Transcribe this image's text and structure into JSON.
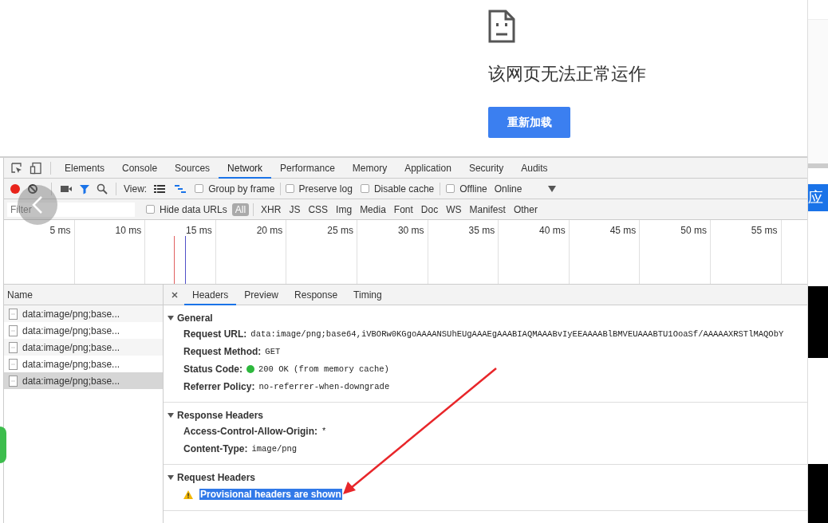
{
  "error_page": {
    "message": "该网页无法正常运作",
    "button": "重新加载"
  },
  "devtools": {
    "tabs": [
      {
        "label": "Elements",
        "selected": false
      },
      {
        "label": "Console",
        "selected": false
      },
      {
        "label": "Sources",
        "selected": false
      },
      {
        "label": "Network",
        "selected": true
      },
      {
        "label": "Performance",
        "selected": false
      },
      {
        "label": "Memory",
        "selected": false
      },
      {
        "label": "Application",
        "selected": false
      },
      {
        "label": "Security",
        "selected": false
      },
      {
        "label": "Audits",
        "selected": false
      }
    ],
    "toolbar": {
      "recording": true,
      "filter_active": true,
      "view_label": "View:",
      "view_modes": [
        {
          "kind": "list",
          "selected": false
        },
        {
          "kind": "waterfall",
          "selected": true
        }
      ],
      "options": [
        {
          "label": "Group by frame",
          "checked": false
        },
        {
          "label": "Preserve log",
          "checked": false
        },
        {
          "label": "Disable cache",
          "checked": false
        }
      ],
      "offline": {
        "label": "Offline",
        "checked": false
      },
      "throttling": "Online"
    },
    "filter_bar": {
      "placeholder": "Filter",
      "hide_data_urls": {
        "label": "Hide data URLs",
        "checked": false
      },
      "types": [
        {
          "label": "All",
          "selected": true
        },
        {
          "label": "XHR",
          "selected": false
        },
        {
          "label": "JS",
          "selected": false
        },
        {
          "label": "CSS",
          "selected": false
        },
        {
          "label": "Img",
          "selected": false
        },
        {
          "label": "Media",
          "selected": false
        },
        {
          "label": "Font",
          "selected": false
        },
        {
          "label": "Doc",
          "selected": false
        },
        {
          "label": "WS",
          "selected": false
        },
        {
          "label": "Manifest",
          "selected": false
        },
        {
          "label": "Other",
          "selected": false
        }
      ]
    },
    "timeline": {
      "ticks": [
        "5 ms",
        "10 ms",
        "15 ms",
        "20 ms",
        "25 ms",
        "30 ms",
        "35 ms",
        "40 ms",
        "45 ms",
        "50 ms",
        "55 ms"
      ]
    },
    "requests": {
      "column": "Name",
      "rows": [
        {
          "name": "data:image/png;base...",
          "selected": false
        },
        {
          "name": "data:image/png;base...",
          "selected": false
        },
        {
          "name": "data:image/png;base...",
          "selected": false
        },
        {
          "name": "data:image/png;base...",
          "selected": false
        },
        {
          "name": "data:image/png;base...",
          "selected": true
        }
      ]
    },
    "details": {
      "tabs": [
        {
          "label": "Headers",
          "selected": true
        },
        {
          "label": "Preview",
          "selected": false
        },
        {
          "label": "Response",
          "selected": false
        },
        {
          "label": "Timing",
          "selected": false
        }
      ],
      "sections": [
        {
          "title": "General",
          "expanded": true,
          "rows": [
            {
              "key": "Request URL:",
              "value": "data:image/png;base64,iVBORw0KGgoAAAANSUhEUgAAAEgAAABIAQMAAABvIyEEAAAABlBMVEUAAABTU1OoaSf/AAAAAXRSTlMAQObY"
            },
            {
              "key": "Request Method:",
              "value": "GET"
            },
            {
              "key": "Status Code:",
              "value": "200 OK (from memory cache)",
              "kind": "status"
            },
            {
              "key": "Referrer Policy:",
              "value": "no-referrer-when-downgrade"
            }
          ]
        },
        {
          "title": "Response Headers",
          "expanded": true,
          "rows": [
            {
              "key": "Access-Control-Allow-Origin:",
              "value": "*"
            },
            {
              "key": "Content-Type:",
              "value": "image/png"
            }
          ]
        },
        {
          "title": "Request Headers",
          "expanded": true,
          "warning": {
            "text": "Provisional headers are shown",
            "selected": true
          }
        }
      ]
    }
  },
  "side_strip": {
    "text": "应"
  }
}
